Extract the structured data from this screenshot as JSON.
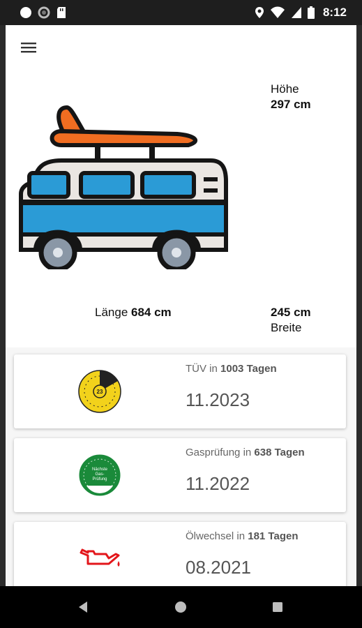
{
  "status_bar": {
    "time": "8:12",
    "left_icons": [
      "circle-icon",
      "sync-icon",
      "sd-card-icon"
    ],
    "right_icons": [
      "location-icon",
      "wifi-icon",
      "signal-icon",
      "battery-icon"
    ]
  },
  "app_bar": {
    "menu_icon": "menu-icon"
  },
  "vehicle": {
    "icon": "camper-van-icon",
    "height_label": "Höhe",
    "height_value": "297 cm",
    "length_label": "Länge",
    "length_value": "684 cm",
    "width_value": "245 cm",
    "width_label": "Breite"
  },
  "cards": [
    {
      "icon": "tuev-sticker-icon",
      "name": "TÜV",
      "in_word": "in",
      "days": "1003 Tagen",
      "date": "11.2023",
      "sticker_color": "#f2d21b"
    },
    {
      "icon": "gas-inspection-sticker-icon",
      "name": "Gasprüfung",
      "in_word": "in",
      "days": "638 Tagen",
      "date": "11.2022",
      "sticker_color": "#1a8a3a"
    },
    {
      "icon": "oil-can-icon",
      "name": "Ölwechsel",
      "in_word": "in",
      "days": "181 Tagen",
      "date": "08.2021",
      "icon_color": "#e3161b"
    }
  ],
  "nav_bar": {
    "back_icon": "back-icon",
    "home_icon": "home-icon",
    "recents_icon": "recents-icon"
  },
  "colors": {
    "van_blue": "#2b9bd6",
    "van_white": "#eae6e2",
    "surfboard": "#f06d21",
    "outline": "#151515"
  }
}
